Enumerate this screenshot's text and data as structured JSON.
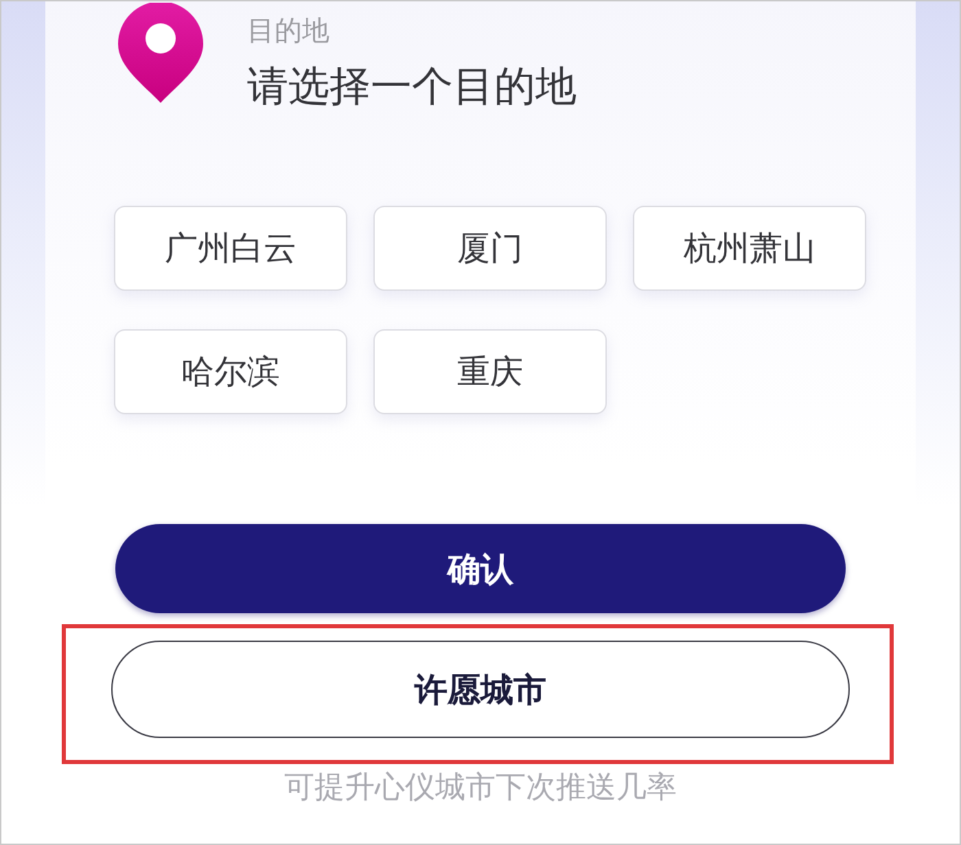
{
  "header": {
    "label": "目的地",
    "title": "请选择一个目的地"
  },
  "cities": [
    {
      "name": "广州白云",
      "selected": false
    },
    {
      "name": "厦门",
      "selected": false
    },
    {
      "name": "杭州萧山",
      "selected": false
    },
    {
      "name": "哈尔滨",
      "selected": false
    },
    {
      "name": "重庆",
      "selected": false
    }
  ],
  "confirm_button": {
    "label": "确认"
  },
  "wish_button": {
    "label": "许愿城市",
    "highlighted": true
  },
  "hint": "可提升心仪城市下次推送几率"
}
